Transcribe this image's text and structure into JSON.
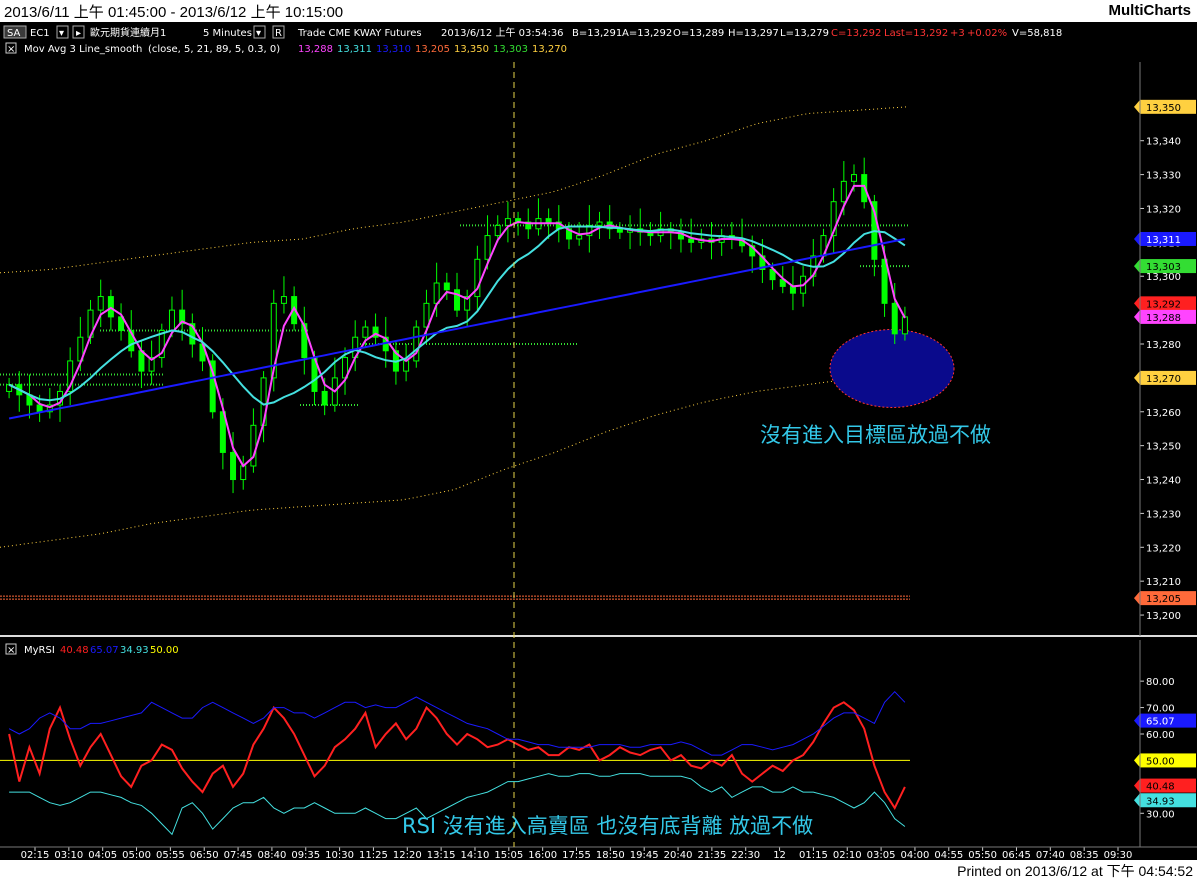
{
  "window": {
    "period": "2013/6/11 上午 01:45:00 - 2013/6/12 上午 10:15:00",
    "brand": "MultiCharts"
  },
  "footer": {
    "printed": "Printed on 2013/6/12 at 下午 04:54:52"
  },
  "symbol_bar": {
    "mode_button": "SA",
    "instrument": "EC1",
    "name": "歐元期貨連續月1",
    "resolution": "5 Minutes",
    "source": "Trade CME KWAY Futures",
    "quote": "2013/6/12 上午 03:54:36",
    "bid": "B=13,291",
    "ask": "A=13,292",
    "open": "O=13,289",
    "high": "H=13,297",
    "low": "L=13,279",
    "close": "C=13,292",
    "last": "Last=13,292",
    "change": "+3",
    "change_pct": "+0.02%",
    "volume": "V=58,818"
  },
  "study_bar": {
    "name": "Mov Avg 3 Line_smooth",
    "params": "(close, 5, 21, 89, 5, 0.3, 0)",
    "values": [
      "13,288",
      "13,311",
      "13,310",
      "13,205",
      "13,350",
      "13,303",
      "13,270"
    ],
    "value_colors": [
      "#ff44ff",
      "#44e0e0",
      "#1a1aff",
      "#ff6a3a",
      "#ffd040",
      "#33dd33",
      "#ffd040"
    ]
  },
  "rsi_bar": {
    "name": "MyRSI",
    "values": [
      "40.48",
      "65.07",
      "34.93",
      "50.00"
    ],
    "value_colors": [
      "#ff2020",
      "#1a1aff",
      "#44e0e0",
      "#ffff00"
    ]
  },
  "annotations": {
    "price_note": "沒有進入目標區放過不做",
    "rsi_note": "RSI 沒有進入高賣區 也沒有底背離 放過不做"
  },
  "colors": {
    "background": "#000000",
    "price_bars": "#00ff00",
    "ma_fast": "#ff44ff",
    "ma_mid": "#44e0e0",
    "ma_slow": "#1a1aff",
    "band": "#ffd040",
    "rsi": "#ff2020",
    "rsi_slow": "#1a1aff",
    "rsi_cyan": "#44e0e0",
    "rsi_mid": "#ffff00",
    "target_zone": "#0a0a8c",
    "annotation": "#33c8e8"
  },
  "chart_data": [
    {
      "type": "candlestick",
      "panel": "price",
      "ylim": [
        13195,
        13365
      ],
      "yticks": [
        "13,200",
        "13,210",
        "13,220",
        "13,230",
        "13,240",
        "13,250",
        "13,260",
        "13,270",
        "13,280",
        "13,290",
        "13,300",
        "13,310",
        "13,320",
        "13,330",
        "13,340"
      ],
      "xticks": [
        "02:15",
        "03:10",
        "04:05",
        "05:00",
        "05:55",
        "06:50",
        "07:45",
        "08:40",
        "09:35",
        "10:30",
        "11:25",
        "12:20",
        "13:15",
        "14:10",
        "15:05",
        "16:00",
        "17:55",
        "18:50",
        "19:45",
        "20:40",
        "21:35",
        "22:30",
        "12",
        "01:15",
        "02:10",
        "03:05",
        "04:00",
        "04:55",
        "05:50",
        "06:45",
        "07:40",
        "08:35",
        "09:30"
      ],
      "close": [
        13268,
        13265,
        13262,
        13260,
        13262,
        13266,
        13275,
        13282,
        13290,
        13294,
        13288,
        13284,
        13278,
        13272,
        13276,
        13284,
        13290,
        13286,
        13280,
        13275,
        13260,
        13248,
        13240,
        13244,
        13256,
        13270,
        13292,
        13294,
        13286,
        13276,
        13266,
        13262,
        13270,
        13276,
        13282,
        13285,
        13282,
        13278,
        13272,
        13275,
        13285,
        13292,
        13298,
        13296,
        13290,
        13294,
        13305,
        13312,
        13315,
        13317,
        13316,
        13314,
        13317,
        13316,
        13314,
        13311,
        13312,
        13315,
        13316,
        13314,
        13313,
        13314,
        13313,
        13312,
        13314,
        13313,
        13311,
        13310,
        13311,
        13310,
        13312,
        13311,
        13309,
        13306,
        13302,
        13299,
        13297,
        13295,
        13300,
        13306,
        13312,
        13322,
        13328,
        13330,
        13322,
        13305,
        13292,
        13283,
        13288
      ],
      "ma_values": {
        "fast": "13,288",
        "mid": "13,311",
        "slow": "13,310"
      },
      "band_upper": [
        13301,
        13302,
        13304,
        13306,
        13308,
        13310,
        13311,
        13314,
        13316,
        13319,
        13322,
        13325,
        13330,
        13336,
        13340,
        13345,
        13348,
        13349,
        13350
      ],
      "band_lower": [
        13220,
        13222,
        13224,
        13227,
        13229,
        13231,
        13232,
        13233,
        13234,
        13237,
        13243,
        13248,
        13254,
        13259,
        13263,
        13266,
        13268,
        13270,
        13270
      ],
      "target_zone": [
        13270,
        13285
      ],
      "hlines": [
        13205
      ],
      "price_labels": [
        {
          "value": 13350,
          "text": "13,350",
          "color": "#ffd040"
        },
        {
          "value": 13311,
          "text": "13,311",
          "color": "#1a1aff"
        },
        {
          "value": 13303,
          "text": "13,303",
          "color": "#33dd33"
        },
        {
          "value": 13292,
          "text": "13,292",
          "color": "#ff2020"
        },
        {
          "value": 13288,
          "text": "13,288",
          "color": "#ff44ff"
        },
        {
          "value": 13270,
          "text": "13,270",
          "color": "#ffd040"
        },
        {
          "value": 13205,
          "text": "13,205",
          "color": "#ff6a3a"
        }
      ]
    },
    {
      "type": "line",
      "panel": "rsi",
      "ylim": [
        18,
        88
      ],
      "yticks": [
        "30.00",
        "40.00",
        "50.00",
        "60.00",
        "70.00",
        "80.00"
      ],
      "series": [
        {
          "name": "MyRSI",
          "color": "#ff2020",
          "values": [
            60,
            42,
            55,
            45,
            62,
            70,
            58,
            48,
            55,
            60,
            52,
            44,
            40,
            48,
            50,
            56,
            54,
            47,
            42,
            38,
            45,
            48,
            40,
            45,
            56,
            62,
            70,
            66,
            60,
            52,
            44,
            48,
            55,
            58,
            62,
            68,
            55,
            60,
            64,
            58,
            62,
            70,
            66,
            60,
            56,
            60,
            58,
            55,
            56,
            58,
            56,
            54,
            55,
            52,
            52,
            55,
            54,
            56,
            50,
            52,
            55,
            53,
            52,
            54,
            55,
            50,
            52,
            48,
            47,
            50,
            48,
            52,
            45,
            42,
            45,
            48,
            46,
            50,
            52,
            57,
            64,
            70,
            72,
            69,
            62,
            48,
            38,
            32,
            40
          ]
        },
        {
          "name": "",
          "color": "#1a1aff",
          "values": [
            62,
            60,
            62,
            66,
            68,
            66,
            62,
            62,
            64,
            64,
            65,
            66,
            67,
            68,
            72,
            70,
            68,
            66,
            66,
            70,
            72,
            70,
            68,
            66,
            64,
            66,
            70,
            70,
            68,
            68,
            66,
            68,
            70,
            72,
            72,
            70,
            71,
            70,
            70,
            72,
            74,
            72,
            70,
            68,
            66,
            64,
            63,
            62,
            60,
            58,
            58,
            57,
            56,
            56,
            55,
            55,
            55,
            55,
            56,
            56,
            56,
            55,
            55,
            56,
            56,
            56,
            57,
            56,
            54,
            52,
            52,
            54,
            56,
            56,
            55,
            54,
            55,
            56,
            58,
            60,
            63,
            66,
            68,
            68,
            66,
            64,
            72,
            76,
            72
          ]
        },
        {
          "name": "",
          "color": "#44e0e0",
          "values": [
            38,
            38,
            38,
            36,
            34,
            33,
            34,
            36,
            38,
            38,
            37,
            36,
            34,
            33,
            30,
            26,
            22,
            32,
            34,
            30,
            24,
            28,
            32,
            34,
            34,
            36,
            32,
            30,
            32,
            32,
            34,
            32,
            30,
            30,
            30,
            32,
            30,
            28,
            28,
            30,
            32,
            28,
            30,
            32,
            34,
            36,
            37,
            38,
            40,
            42,
            42,
            43,
            44,
            45,
            44,
            44,
            45,
            45,
            44,
            44,
            45,
            45,
            45,
            44,
            44,
            44,
            44,
            43,
            40,
            38,
            40,
            36,
            38,
            40,
            40,
            38,
            38,
            40,
            38,
            38,
            37,
            36,
            34,
            32,
            34,
            38,
            34,
            28,
            25
          ]
        }
      ],
      "hlines": [
        50
      ],
      "rsi_labels": [
        {
          "value": 65.07,
          "text": "65.07",
          "color": "#1a1aff"
        },
        {
          "value": 50,
          "text": "50.00",
          "color": "#ffff00"
        },
        {
          "value": 40.48,
          "text": "40.48",
          "color": "#ff2020"
        },
        {
          "value": 34.93,
          "text": "34.93",
          "color": "#44e0e0"
        }
      ]
    }
  ]
}
